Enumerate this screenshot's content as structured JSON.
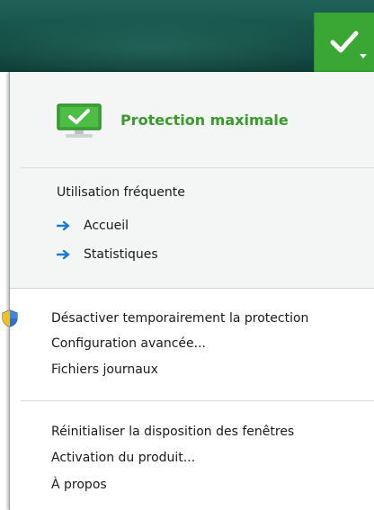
{
  "header": {
    "status_icon": "checkmark-icon",
    "dropdown_icon": "chevron-down-icon",
    "status_color": "#3aa735"
  },
  "protection": {
    "status_label": "Protection maximale",
    "status_icon": "monitor-check-icon",
    "status_color": "#3a9a2c"
  },
  "frequent": {
    "title": "Utilisation fréquente",
    "items": [
      {
        "label": "Accueil",
        "icon": "arrow-right-icon"
      },
      {
        "label": "Statistiques",
        "icon": "arrow-right-icon"
      }
    ]
  },
  "actions": {
    "items": [
      {
        "label": "Désactiver temporairement la protection",
        "icon": "uac-shield-icon"
      },
      {
        "label": "Configuration avancée..."
      },
      {
        "label": "Fichiers journaux"
      }
    ]
  },
  "misc": {
    "items": [
      {
        "label": "Réinitialiser la disposition des fenêtres"
      },
      {
        "label": "Activation du produit..."
      },
      {
        "label": "À propos"
      }
    ]
  }
}
